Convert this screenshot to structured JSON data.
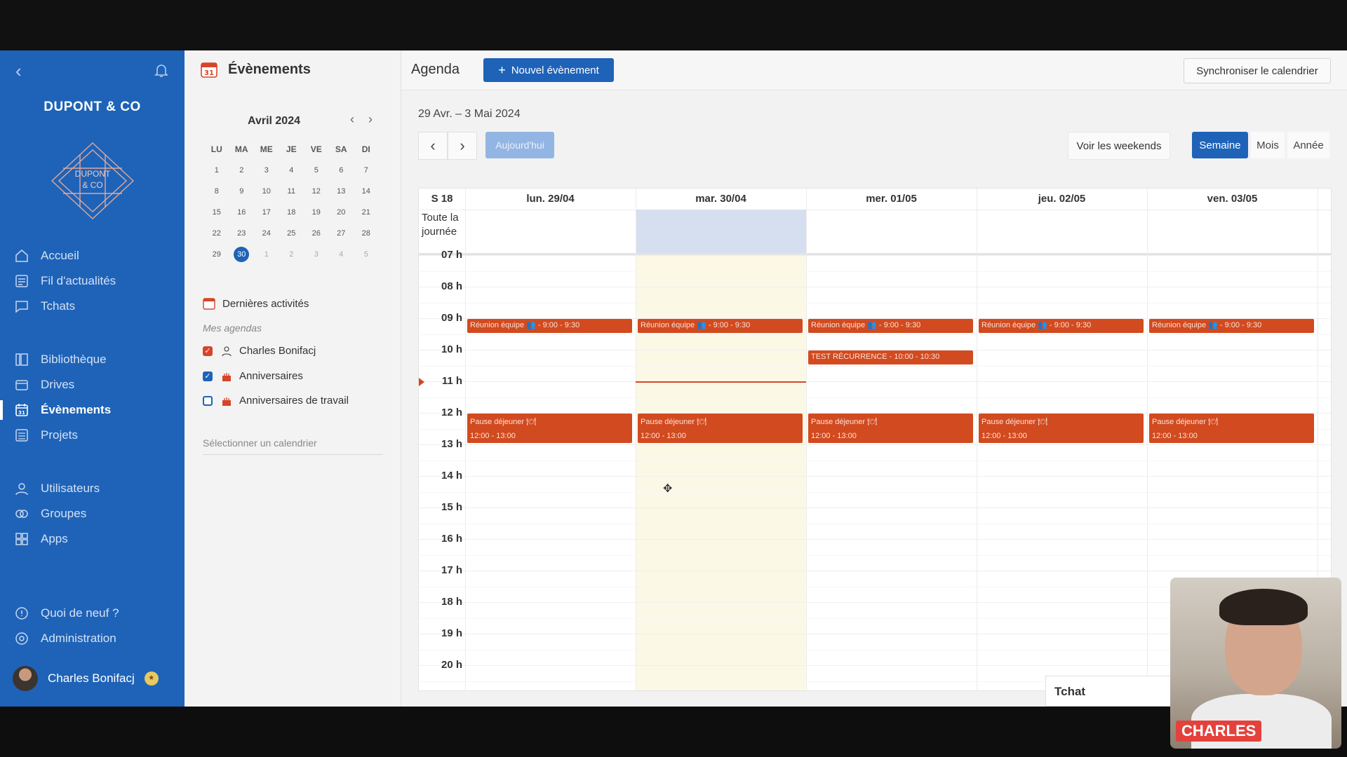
{
  "sidebar": {
    "company": "DUPONT & CO",
    "logo_text": [
      "DUPONT",
      "& CO"
    ],
    "nav": [
      {
        "label": "Accueil",
        "icon": "home-icon"
      },
      {
        "label": "Fil d'actualités",
        "icon": "news-icon"
      },
      {
        "label": "Tchats",
        "icon": "chat-icon"
      },
      {
        "label": "Bibliothèque",
        "icon": "library-icon"
      },
      {
        "label": "Drives",
        "icon": "drive-icon"
      },
      {
        "label": "Évènements",
        "icon": "calendar-icon",
        "active": true
      },
      {
        "label": "Projets",
        "icon": "projects-icon"
      },
      {
        "label": "Utilisateurs",
        "icon": "users-icon"
      },
      {
        "label": "Groupes",
        "icon": "groups-icon"
      },
      {
        "label": "Apps",
        "icon": "apps-icon"
      },
      {
        "label": "Quoi de neuf ?",
        "icon": "help-icon"
      },
      {
        "label": "Administration",
        "icon": "admin-icon"
      }
    ],
    "user": {
      "name": "Charles Bonifacj"
    }
  },
  "left_panel": {
    "title": "Évènements",
    "mini_calendar": {
      "month": "Avril 2024",
      "weekdays": [
        "LU",
        "MA",
        "ME",
        "JE",
        "VE",
        "SA",
        "DI"
      ],
      "weeks": [
        [
          "1",
          "2",
          "3",
          "4",
          "5",
          "6",
          "7"
        ],
        [
          "8",
          "9",
          "10",
          "11",
          "12",
          "13",
          "14"
        ],
        [
          "15",
          "16",
          "17",
          "18",
          "19",
          "20",
          "21"
        ],
        [
          "22",
          "23",
          "24",
          "25",
          "26",
          "27",
          "28"
        ],
        [
          "29",
          "30",
          "1",
          "2",
          "3",
          "4",
          "5"
        ]
      ],
      "today": "30"
    },
    "activities": "Dernières activités",
    "my_calendars_label": "Mes agendas",
    "calendars": [
      {
        "label": "Charles Bonifacj",
        "checked": true,
        "color": "#d6452a"
      },
      {
        "label": "Anniversaires",
        "checked": true,
        "color": "#1e63b8"
      },
      {
        "label": "Anniversaires de travail",
        "checked": false,
        "color": "#1e63b8"
      }
    ],
    "select_placeholder": "Sélectionner un calendrier"
  },
  "main": {
    "title": "Agenda",
    "new_event": "Nouvel évènement",
    "sync": "Synchroniser le calendrier",
    "date_range": "29 Avr. – 3 Mai 2024",
    "today_btn": "Aujourd'hui",
    "weekends_btn": "Voir les weekends",
    "views": [
      "Semaine",
      "Mois",
      "Année"
    ],
    "active_view": "Semaine"
  },
  "calendar": {
    "week_label": "S 18",
    "all_day_label": "Toute la journée",
    "days": [
      "lun. 29/04",
      "mar. 30/04",
      "mer. 01/05",
      "jeu. 02/05",
      "ven. 03/05"
    ],
    "today_index": 1,
    "hours": [
      "07 h",
      "08 h",
      "09 h",
      "10 h",
      "11 h",
      "12 h",
      "13 h",
      "14 h",
      "15 h",
      "16 h",
      "17 h",
      "18 h",
      "19 h",
      "20 h"
    ],
    "now_time": "11:00",
    "events": [
      {
        "day": 0,
        "start": "9:00",
        "end": "9:30",
        "text": "Réunion équipe 👥 - 9:00 - 9:30"
      },
      {
        "day": 1,
        "start": "9:00",
        "end": "9:30",
        "text": "Réunion équipe 👥 - 9:00 - 9:30"
      },
      {
        "day": 2,
        "start": "9:00",
        "end": "9:30",
        "text": "Réunion équipe 👥 - 9:00 - 9:30"
      },
      {
        "day": 3,
        "start": "9:00",
        "end": "9:30",
        "text": "Réunion équipe 👥 - 9:00 - 9:30"
      },
      {
        "day": 4,
        "start": "9:00",
        "end": "9:30",
        "text": "Réunion équipe 👥 - 9:00 - 9:30"
      },
      {
        "day": 2,
        "start": "10:00",
        "end": "10:30",
        "text": "TEST RÉCURRENCE - 10:00 - 10:30"
      },
      {
        "day": 0,
        "start": "12:00",
        "end": "13:00",
        "text": "Pause déjeuner 🍽",
        "time": "12:00 - 13:00"
      },
      {
        "day": 1,
        "start": "12:00",
        "end": "13:00",
        "text": "Pause déjeuner 🍽",
        "time": "12:00 - 13:00"
      },
      {
        "day": 2,
        "start": "12:00",
        "end": "13:00",
        "text": "Pause déjeuner 🍽",
        "time": "12:00 - 13:00"
      },
      {
        "day": 3,
        "start": "12:00",
        "end": "13:00",
        "text": "Pause déjeuner 🍽",
        "time": "12:00 - 13:00"
      },
      {
        "day": 4,
        "start": "12:00",
        "end": "13:00",
        "text": "Pause déjeuner 🍽",
        "time": "12:00 - 13:00"
      }
    ],
    "event_color": "#d24a1f"
  },
  "tchat": {
    "label": "Tchat"
  },
  "video": {
    "name": "CHARLES"
  }
}
